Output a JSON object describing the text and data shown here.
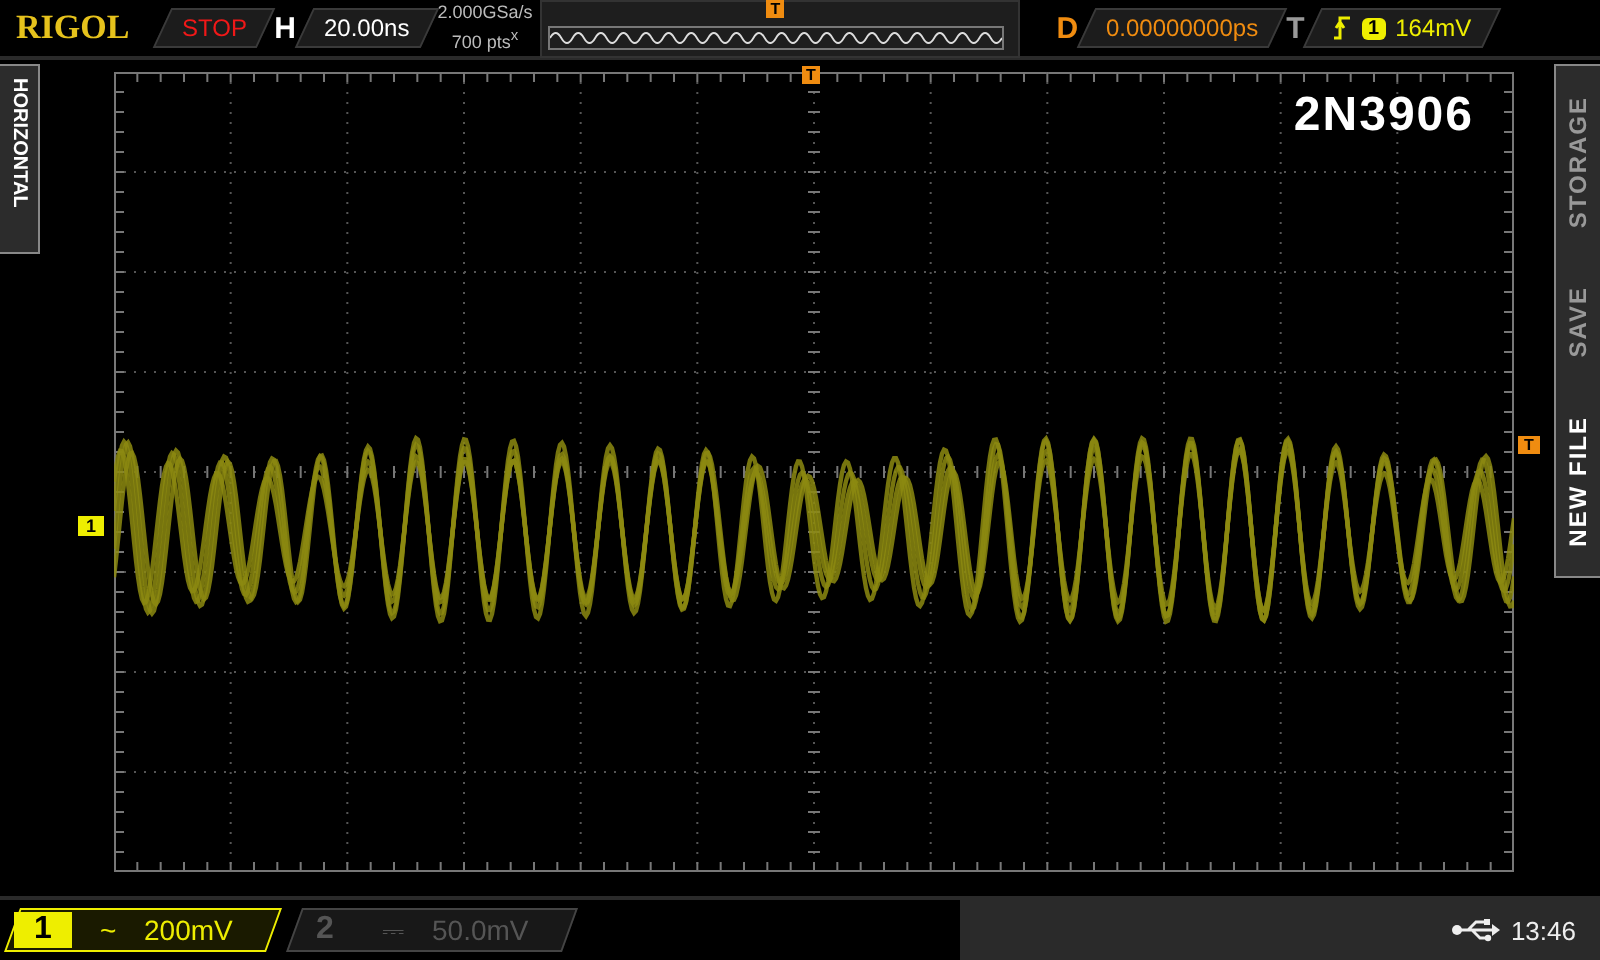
{
  "brand": "RIGOL",
  "run_state": "STOP",
  "timebase": {
    "label": "H",
    "value": "20.00ns"
  },
  "sample_rate": "2.000GSa/s",
  "memory_depth": "700 pts$^{x}$",
  "delay": {
    "label": "D",
    "value": "0.00000000ps"
  },
  "trigger": {
    "label": "T",
    "source": "1",
    "level": "164mV"
  },
  "screen_label": "2N3906",
  "side_tab": "HORIZONTAL",
  "soft_menu": [
    {
      "label": "STORAGE",
      "selected": false
    },
    {
      "label": "SAVE",
      "selected": false
    },
    {
      "label": "NEW FILE",
      "selected": true
    }
  ],
  "channels": [
    {
      "number": "1",
      "coupling": "~",
      "scale": "200mV",
      "on": true
    },
    {
      "number": "2",
      "coupling": "⎓",
      "scale": "50.0mV",
      "on": false
    }
  ],
  "markers": {
    "memory_trigger": "T",
    "trigger_position": "T",
    "trigger_level": "T",
    "channel_1": "1"
  },
  "clock": "13:46"
}
